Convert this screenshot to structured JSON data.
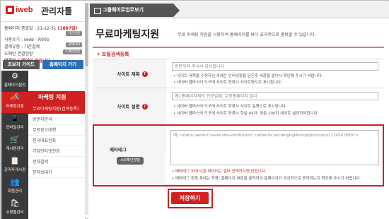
{
  "brand": {
    "logo": "iweb",
    "title": "관리자툴"
  },
  "account": {
    "expiry_label": "홈페이지 종료일 : 21-12-31",
    "expiry_days": "(1887일)",
    "extend_btn": "기간연장",
    "userid_line": "사용쓰기 : iweb - R005",
    "pay_line": "결제유형 : 기간결제",
    "pay_btn": "결제내역",
    "domain_line": "도메인 연결현황",
    "domain_btn": "도메인연결",
    "warning": "연결된 도메인이 없습니다."
  },
  "quick": {
    "guide": "초보자 가이드",
    "home": "홈페이지 가기"
  },
  "nav": [
    {
      "icon": "⚙",
      "label": "홈페이지설정"
    },
    {
      "icon": "📣",
      "label": "마케팅지원"
    },
    {
      "icon": "📱",
      "label": "모바일관리"
    },
    {
      "icon": "🛒",
      "label": "게시판관리"
    },
    {
      "icon": "📋",
      "label": "관리자게시판"
    },
    {
      "icon": "👥",
      "label": "회원관리"
    },
    {
      "icon": "🛍",
      "label": "쇼핑몰관리"
    }
  ],
  "subnav": {
    "title": "마케팅 지원",
    "items": [
      "무료마케팅지원(검색등록)",
      "방문자분석",
      "무료광고대행",
      "전국대표전화",
      "기업인터넷전화",
      "전자결제",
      "문자보내기"
    ]
  },
  "topbar": {
    "tab": "그룹웨어로업무보기"
  },
  "main": {
    "title": "무료마케팅지원",
    "desc": "무료 마케팅 지원을 사용하여 홈페이지를 보다 효과적으로 홍보할 수 있습니다.",
    "section_title": "• 포털검색등록",
    "site_title_label": "사이트 제목",
    "site_title_value": "방문하여 주셔서 감사합니다",
    "site_title_notes": [
      "• 사이트 제목을 수정하신 후에는 인터넷창을 닫은후 새창을 열어서 확인해 주시기 바랍니다.",
      "• 네이버 웹마스터 도구에 사이트 등록시 사이트명으로 표시됩니다."
    ],
    "site_desc_label": "사이트 설명",
    "site_desc_placeholder": "예) 홈페이지제작 전문업체, 무료홈페이지 빌더",
    "site_desc_notes": [
      "• 네이버 웹마스터 도구에 사이트 등록시 사이트 설명으로 표시됩니다.",
      "• 네이버 웹마스터 도구에 사이트 등록시 한글 45자, 영문 100자 내외로 설정하여합니다."
    ],
    "meta_label": "메타태그",
    "meta_btn": "소유확인방법",
    "meta_placeholder": "예) <meta name='naver-site-verification' content='abcdefghijklmnopqrstuvwyz1234567890'/>",
    "meta_notes": [
      "• 메타태그 외에 다른 데이터는 절대 입력하시면 안됩니다.",
      "• 메타태그 등록 후에는 적용/ 홈페이지 버튼을 클릭하여 홈페이지가 정상적으로 동작하는지 확인해 주시기 바랍니다."
    ],
    "save": "저장하기"
  }
}
